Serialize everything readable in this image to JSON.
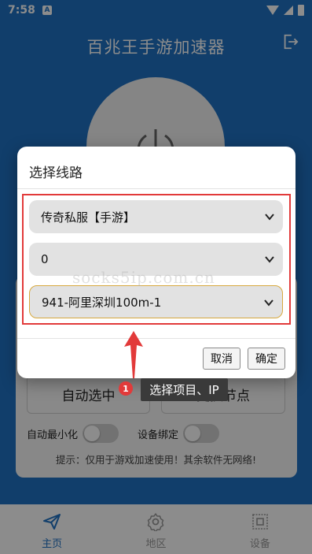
{
  "status_bar": {
    "time": "7:58",
    "a_badge": "A"
  },
  "app": {
    "title": "百兆王手游加速器",
    "auto_select_label": "自动选中",
    "change_node_label": "更换节点",
    "auto_minimize_label": "自动最小化",
    "device_bind_label": "设备绑定",
    "hint": "提示：仅用于游戏加速使用！其余软件无网络!"
  },
  "nav": {
    "items": [
      {
        "label": "主页",
        "icon": "send-icon",
        "active": true
      },
      {
        "label": "地区",
        "icon": "gear-icon",
        "active": false
      },
      {
        "label": "设备",
        "icon": "device-icon",
        "active": false
      }
    ]
  },
  "dialog": {
    "title": "选择线路",
    "select_game": "传奇私服【手游】",
    "select_group": "0",
    "select_node": "941-阿里深圳100m-1",
    "cancel_label": "取消",
    "ok_label": "确定"
  },
  "watermark": "socks5ip.com.cn",
  "annotation": {
    "badge": "1",
    "text": "选择项目、IP",
    "accent": "#e23a3a"
  },
  "colors": {
    "brand": "#1f72c4",
    "highlight": "#e23a3a"
  }
}
